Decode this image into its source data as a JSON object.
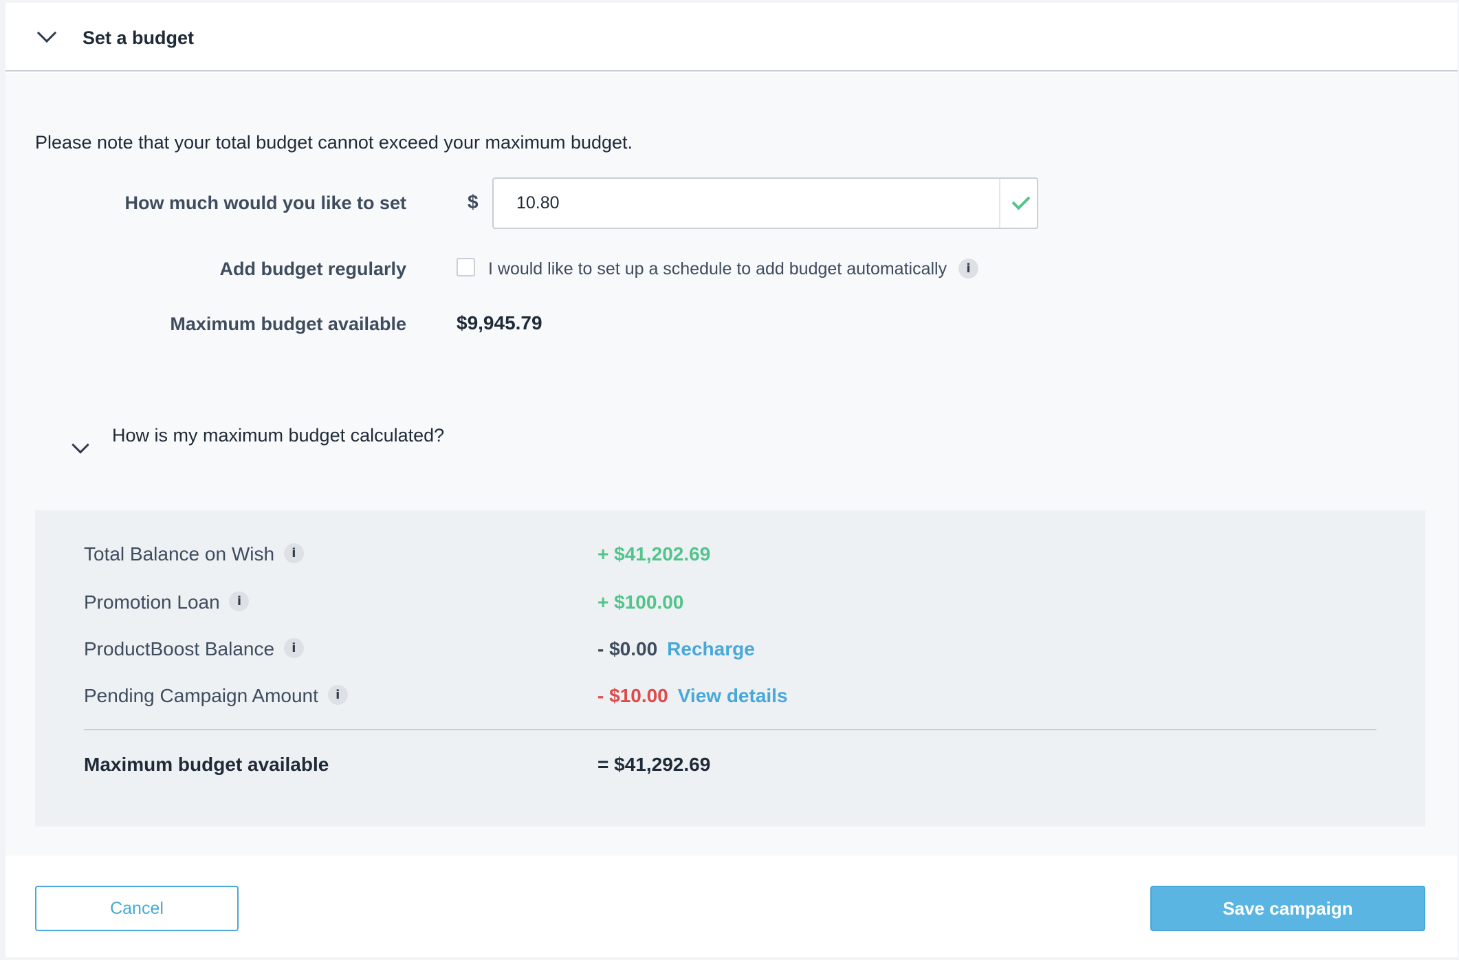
{
  "header": {
    "title": "Set a budget",
    "icon": "chevron-down-icon"
  },
  "note": "Please note that your total budget cannot exceed your maximum budget.",
  "form": {
    "amount_label": "How much would you like to set",
    "currency_symbol": "$",
    "amount_value": "10.80",
    "regular_label": "Add budget regularly",
    "regular_checkbox_label": "I would like to set up a schedule to add budget automatically",
    "regular_checked": false,
    "max_label": "Maximum budget available",
    "max_value": "$9,945.79"
  },
  "calculation": {
    "toggle_text": "How is my maximum budget calculated?",
    "rows": [
      {
        "label": "Total Balance on Wish",
        "value": "+ $41,202.69"
      },
      {
        "label": "Promotion Loan",
        "value": "+ $100.00"
      },
      {
        "label": "ProductBoost Balance",
        "value": "- $0.00",
        "link": "Recharge"
      },
      {
        "label": "Pending Campaign Amount",
        "value": "- $10.00",
        "link": "View details"
      }
    ],
    "total_label": "Maximum budget available",
    "total_value": "= $41,292.69"
  },
  "info_glyph": "i",
  "footer": {
    "cancel_label": "Cancel",
    "save_label": "Save campaign"
  },
  "colors": {
    "accent": "#48a8d8",
    "positive": "#52c48b",
    "negative": "#de4b4b"
  }
}
